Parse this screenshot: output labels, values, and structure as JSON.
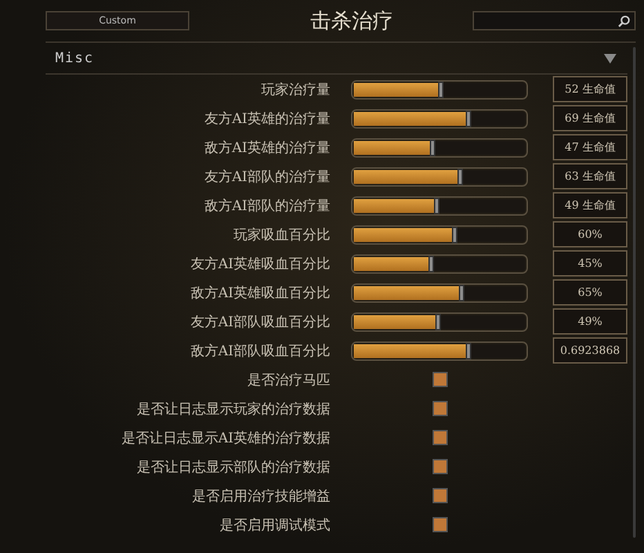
{
  "top_bar": {
    "preset_button": "Custom",
    "title": "击杀治疗"
  },
  "section": {
    "title": "Misc",
    "expanded": true
  },
  "sliders": [
    {
      "label": "玩家治疗量",
      "level": 0.51,
      "reading": "52 生命值"
    },
    {
      "label": "友方AI英雄的治疗量",
      "level": 0.67,
      "reading": "69 生命值"
    },
    {
      "label": "敌方AI英雄的治疗量",
      "level": 0.46,
      "reading": "47 生命值"
    },
    {
      "label": "友方AI部队的治疗量",
      "level": 0.62,
      "reading": "63 生命值"
    },
    {
      "label": "敌方AI部队的治疗量",
      "level": 0.48,
      "reading": "49 生命值"
    },
    {
      "label": "玩家吸血百分比",
      "level": 0.59,
      "reading": "60%"
    },
    {
      "label": "友方AI英雄吸血百分比",
      "level": 0.45,
      "reading": "45%"
    },
    {
      "label": "敌方AI英雄吸血百分比",
      "level": 0.63,
      "reading": "65%"
    },
    {
      "label": "友方AI部队吸血百分比",
      "level": 0.49,
      "reading": "49%"
    },
    {
      "label": "敌方AI部队吸血百分比",
      "level": 0.67,
      "reading": "0.6923868"
    }
  ],
  "checkboxes": [
    {
      "label": "是否治疗马匹",
      "checked": true
    },
    {
      "label": "是否让日志显示玩家的治疗数据",
      "checked": true
    },
    {
      "label": "是否让日志显示AI英雄的治疗数据",
      "checked": true
    },
    {
      "label": "是否让日志显示部队的治疗数据",
      "checked": true
    },
    {
      "label": "是否启用治疗技能增益",
      "checked": true
    },
    {
      "label": "是否启用调试模式",
      "checked": true
    }
  ]
}
